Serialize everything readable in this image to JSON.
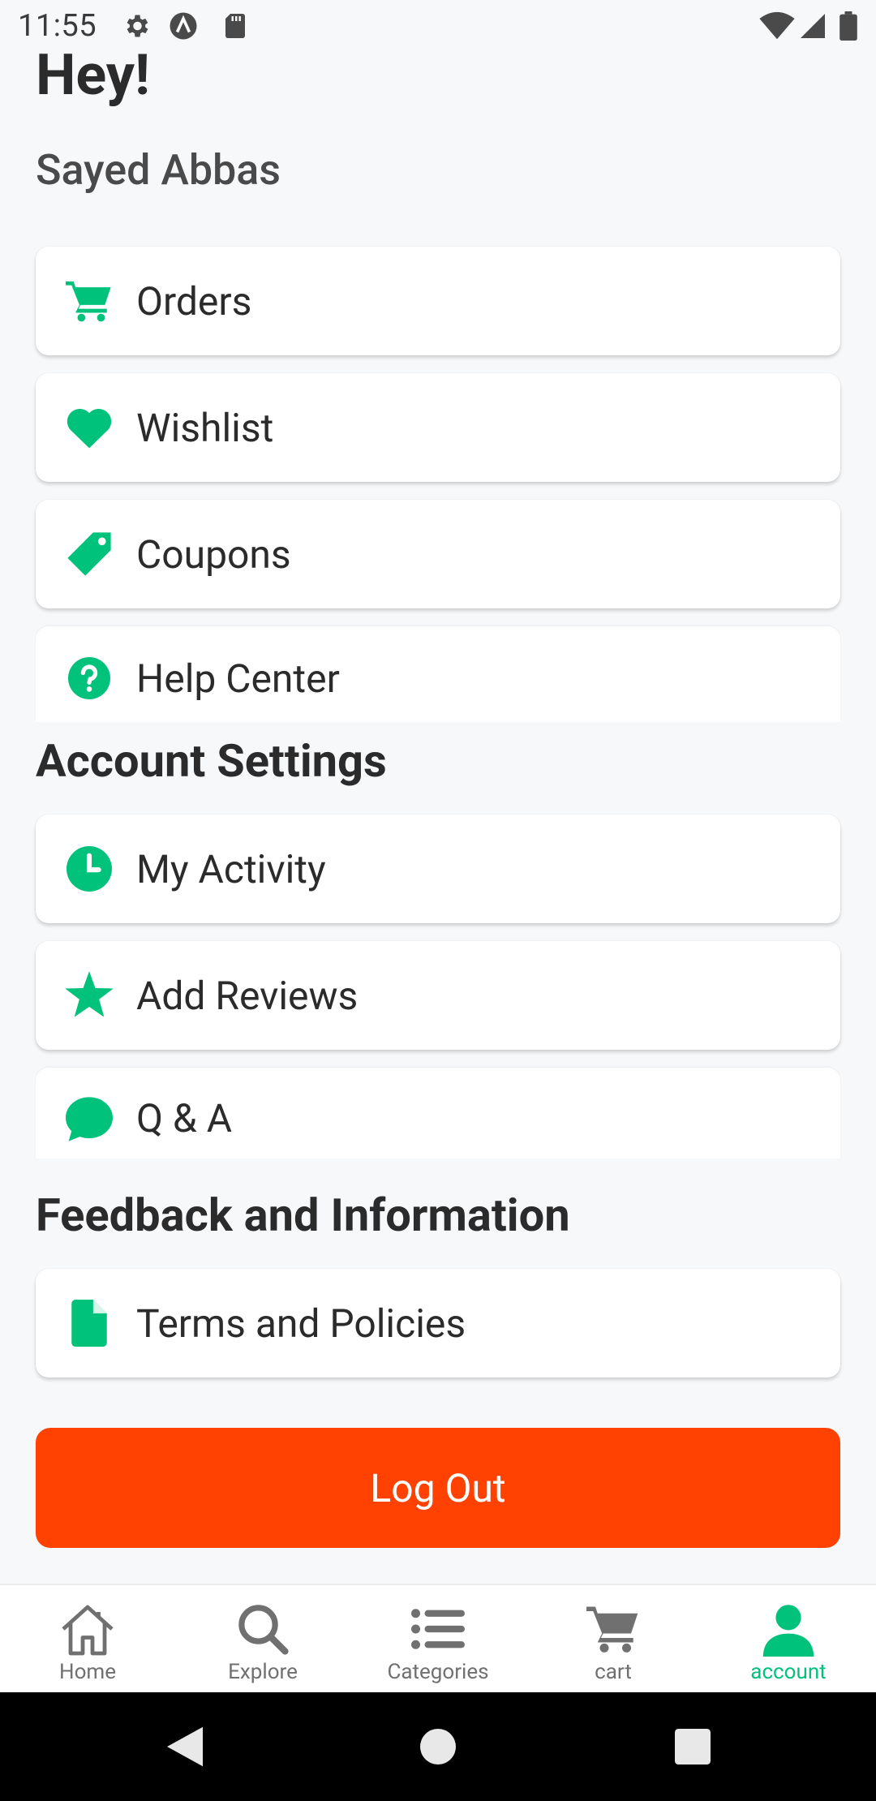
{
  "status_bar": {
    "time": "11:55",
    "icons_left": [
      "gear-icon",
      "a-circle-icon",
      "sd-card-icon"
    ],
    "icons_right": [
      "wifi-icon",
      "signal-icon",
      "battery-icon"
    ]
  },
  "header": {
    "greeting": "Hey!",
    "user_name": "Sayed Abbas"
  },
  "menu": {
    "items": [
      {
        "label": "Orders",
        "icon": "cart-icon"
      },
      {
        "label": "Wishlist",
        "icon": "heart-icon"
      },
      {
        "label": "Coupons",
        "icon": "tag-icon"
      },
      {
        "label": "Help Center",
        "icon": "help-circle-icon"
      }
    ]
  },
  "account_settings": {
    "title": "Account Settings",
    "items": [
      {
        "label": "My Activity",
        "icon": "clock-icon"
      },
      {
        "label": "Add Reviews",
        "icon": "star-icon"
      },
      {
        "label": "Q & A",
        "icon": "chat-bubble-icon"
      }
    ]
  },
  "feedback": {
    "title": "Feedback and Information",
    "items": [
      {
        "label": "Terms and Policies",
        "icon": "document-icon"
      }
    ]
  },
  "logout_label": "Log Out",
  "bottom_nav": {
    "items": [
      {
        "label": "Home",
        "icon": "home-icon",
        "active": false
      },
      {
        "label": "Explore",
        "icon": "search-icon",
        "active": false
      },
      {
        "label": "Categories",
        "icon": "list-icon",
        "active": false
      },
      {
        "label": "cart",
        "icon": "cart-icon",
        "active": false
      },
      {
        "label": "account",
        "icon": "person-icon",
        "active": true
      }
    ]
  },
  "colors": {
    "accent": "#00c27a",
    "logout": "#ff4102",
    "background": "#f7f8fa",
    "nav_inactive": "#707070"
  }
}
